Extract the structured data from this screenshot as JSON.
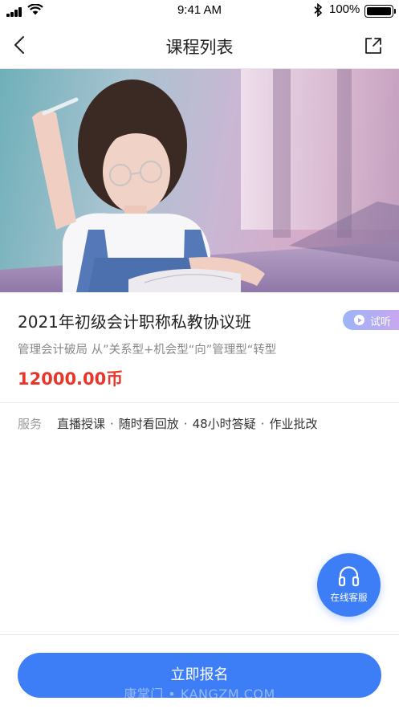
{
  "status_bar": {
    "time": "9:41 AM",
    "battery_percent": "100%",
    "icons": [
      "signal-icon",
      "wifi-icon",
      "bluetooth-icon",
      "battery-icon"
    ]
  },
  "nav": {
    "title": "课程列表",
    "back_icon": "chevron-left-icon",
    "share_icon": "share-icon"
  },
  "course": {
    "title": "2021年初级会计职称私教协议班",
    "trial_label": "试听",
    "subtitle": "管理会计破局 从”关系型+机会型“向”管理型“转型",
    "price": "12000.00币"
  },
  "services": {
    "label": "服务",
    "items": [
      "直播授课",
      "随时看回放",
      "48小时答疑",
      "作业批改"
    ]
  },
  "customer_service": {
    "label": "在线客服",
    "icon": "headphones-icon"
  },
  "bottom": {
    "enroll_label": "立即报名",
    "watermark": "康掌门 • KANGZM.COM"
  },
  "colors": {
    "accent": "#3d7ef6",
    "price": "#e8372a",
    "trial_gradient_start": "#9db4f7",
    "trial_gradient_end": "#c7a7ef"
  }
}
